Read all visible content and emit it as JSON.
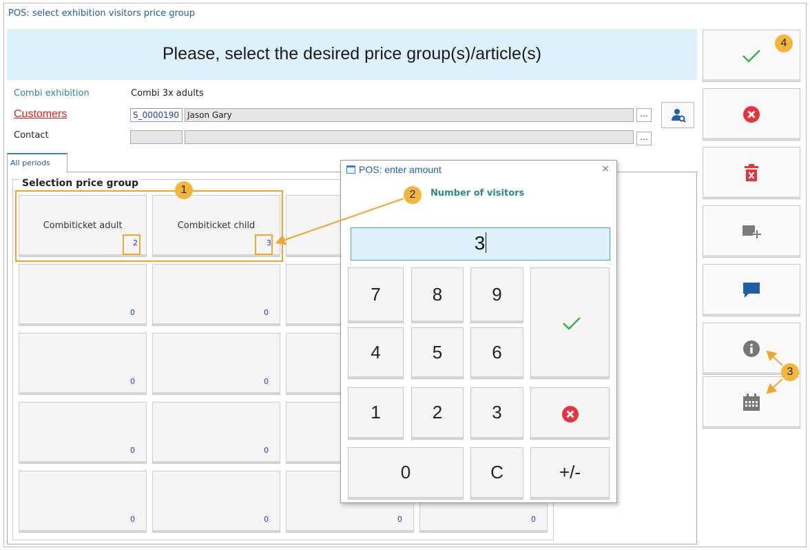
{
  "window": {
    "title": "POS: select exhibition visitors price group"
  },
  "banner": {
    "text": "Please, select the desired price group(s)/article(s)"
  },
  "form": {
    "combi_label": "Combi exhibition",
    "combi_value": "Combi 3x adults",
    "customers_label": "Customers",
    "customer_code": "S_0000190",
    "customer_name": "Jason Gary",
    "contact_label": "Contact",
    "contact_code": "",
    "contact_name": "",
    "ellipsis": "..."
  },
  "tabs": [
    {
      "label": "All periods"
    }
  ],
  "group": {
    "title": "Selection price group",
    "tiles": [
      {
        "name": "Combiticket adult",
        "count": "2"
      },
      {
        "name": "Combiticket child",
        "count": "3"
      },
      {
        "name": "",
        "count": "0"
      },
      {
        "name": "",
        "count": "0"
      },
      {
        "name": "",
        "count": "0"
      },
      {
        "name": "",
        "count": "0"
      },
      {
        "name": "",
        "count": "0"
      },
      {
        "name": "",
        "count": "0"
      },
      {
        "name": "",
        "count": "0"
      },
      {
        "name": "",
        "count": "0"
      },
      {
        "name": "",
        "count": "0"
      },
      {
        "name": "",
        "count": "0"
      }
    ]
  },
  "dialog": {
    "title": "POS: enter amount",
    "close": "×",
    "subtitle": "Number of visitors",
    "value": "3",
    "keys": [
      "7",
      "8",
      "9",
      "4",
      "5",
      "6",
      "1",
      "2",
      "3",
      "0",
      "C",
      "+/-"
    ]
  },
  "badges": {
    "b1": "1",
    "b2": "2",
    "b3": "3",
    "b4": "4"
  },
  "colors": {
    "accent_blue": "#1f5fa8",
    "confirm_green": "#35b34a",
    "cancel_red": "#e8333a",
    "badge_orange": "#f2b73a",
    "teal": "#2e8a8a",
    "banner_bg": "#ddf1fb"
  },
  "side_buttons": [
    "check-icon",
    "cancel-icon",
    "delete-icon",
    "add-image-icon",
    "comment-icon",
    "info-icon",
    "calendar-icon"
  ]
}
